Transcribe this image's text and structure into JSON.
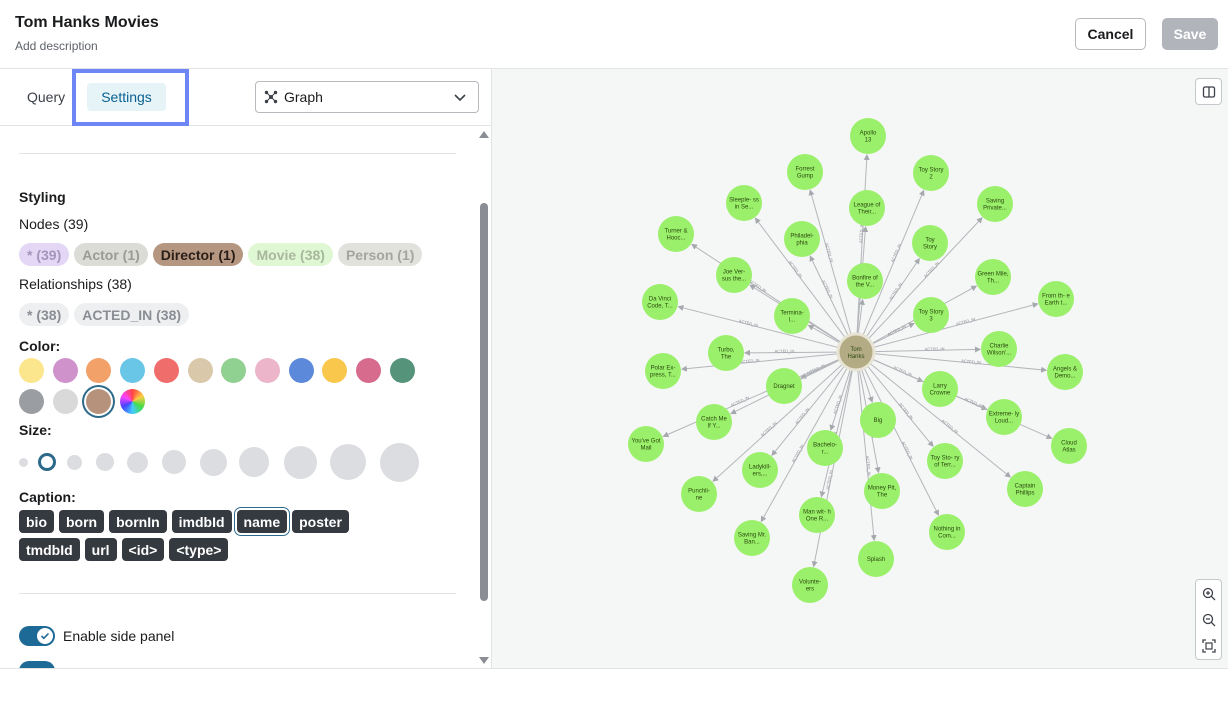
{
  "header": {
    "title": "Tom Hanks Movies",
    "description": "Add description",
    "cancel_label": "Cancel",
    "save_label": "Save"
  },
  "tabs": {
    "query": "Query",
    "settings": "Settings"
  },
  "view_select": {
    "icon": "graph-icon",
    "value": "Graph"
  },
  "styling": {
    "heading": "Styling",
    "nodes_label": "Nodes (39)",
    "node_chips": [
      {
        "label": "* (39)",
        "bg": "#e3d7f5",
        "fg": "#a495bb"
      },
      {
        "label": "Actor (1)",
        "bg": "#dbdcd6",
        "fg": "#9a9c94"
      },
      {
        "label": "Director (1)",
        "bg": "#b59680",
        "fg": "#2a1f18"
      },
      {
        "label": "Movie (38)",
        "bg": "#e0f7d3",
        "fg": "#a8b89d"
      },
      {
        "label": "Person (1)",
        "bg": "#e1e2dc",
        "fg": "#a3a59e"
      }
    ],
    "relationships_label": "Relationships (38)",
    "rel_chips": [
      {
        "label": "* (38)",
        "bg": "#eeeff0",
        "fg": "#8a8e94"
      },
      {
        "label": "ACTED_IN (38)",
        "bg": "#eeeff0",
        "fg": "#8a8e94"
      }
    ],
    "color_label": "Color:",
    "colors": [
      "#fce68d",
      "#cf92cb",
      "#f2a169",
      "#6ac6e7",
      "#ef6e6c",
      "#d9c8a9",
      "#90d090",
      "#ecb5c9",
      "#5d89db",
      "#fac74d",
      "#d76b8e",
      "#55937b",
      "#9a9da2",
      "#d9d9da",
      "#b6917b",
      "rainbow"
    ],
    "selected_color": "#b6917b",
    "size_label": "Size:",
    "selected_size_index": 1,
    "caption_label": "Caption:",
    "captions": [
      "bio",
      "born",
      "bornIn",
      "imdbId",
      "name",
      "poster",
      "tmdbId",
      "url",
      "<id>",
      "<type>"
    ],
    "selected_caption": "name"
  },
  "toggles": {
    "side_panel_label": "Enable side panel",
    "side_panel_on": true
  },
  "graph": {
    "center": "Tom Hanks",
    "edge_label": "ACTED_IN",
    "node_color": "#9af06a",
    "center_color": "#b3ab84",
    "movies": [
      "Apollo 13",
      "Forrest Gump",
      "Toy Story 2",
      "Sleeple- ss in Se...",
      "League of Their...",
      "Saving Private...",
      "Turner & Hooc...",
      "Philadel- phia",
      "Toy Story",
      "Joe Ver- sus the...",
      "Bonfire of the V...",
      "Green Mile, Th...",
      "Da Vinci Code, T...",
      "Termina- l...",
      "Toy Story 3",
      "From th- e Earth t...",
      "Turbo, The",
      "Charlie Wilson'...",
      "Polar Ex- press, T...",
      "Dragnet",
      "Angels & Demo...",
      "Larry Crowne",
      "Catch Me If Y...",
      "Extreme- ly Loud...",
      "You've Got Mail",
      "Big",
      "Cloud Atlas",
      "Bachelo- r...",
      "Toy Sto- ry of Terr...",
      "Ladykill- ers,...",
      "Captain Phillips",
      "Punchli- ne",
      "Money Pit, The",
      "Man wit- h One R...",
      "Nothing in Com...",
      "Saving Mr. Ban...",
      "Splash",
      "Volunte- ers"
    ]
  }
}
